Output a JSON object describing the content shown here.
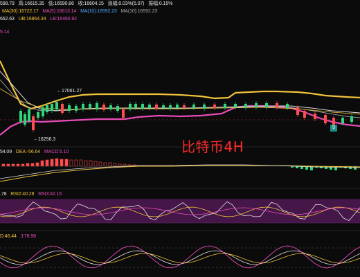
{
  "header": {
    "row1": {
      "open": "598.79",
      "high": "高:16615.35",
      "low": "低:16590.86",
      "close": "收:16604.15",
      "change_pct": "涨幅:0.03%(5.07)",
      "amplitude": "振幅:0.15%"
    },
    "row2": {
      "ma30": "MA(30):16722.17",
      "ma5": "MA(5):16613.14",
      "ma10a": "MA(10):16592.23",
      "ma10b": "MA(10):16592.23"
    },
    "row3": {
      "mb": "662.63",
      "ub": "UB:16864.34",
      "lb": "LB:16460.92"
    },
    "row4": {
      "value": "5.14"
    }
  },
  "price_labels": {
    "high": "17061.27",
    "low": "16256.3"
  },
  "macd_header": {
    "dif": "54.09",
    "dea": "DEA:-56.64",
    "macd": "MACD:5.10"
  },
  "rsi_header": {
    "rsi1": ".78",
    "rsi2": "RSI2:40.28",
    "rsi3": "RSI3:42.15"
  },
  "kdj_header": {
    "k": "D:46.44",
    "j": "J:78.98"
  },
  "watermark": "比特币4H",
  "badge": "9",
  "colors": {
    "gold": "#f0c23a",
    "pink": "#e84bb8",
    "white": "#e6e6e6",
    "green": "#2fd67a",
    "red": "#ff4d4d",
    "purple": "#5a1b5e"
  }
}
